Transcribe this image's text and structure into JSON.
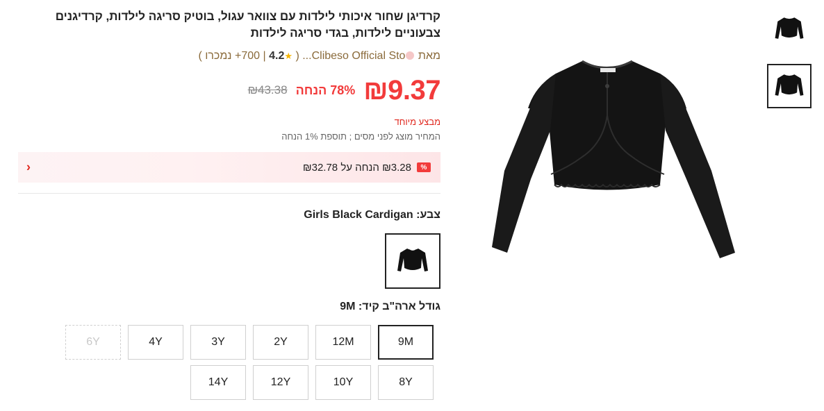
{
  "product": {
    "title": "קרדיגן שחור איכותי לילדות עם צוואר עגול, בוטיק סריגה לילדות, קרדיגנים צבעוניים לילדות, בגדי סריגה לילדות",
    "store_prefix": "מאת",
    "store_name": "Clibeso Official Sto...",
    "rating_open": "(",
    "rating_count": "700",
    "rating_sep": "|",
    "rating_value": "4.2",
    "rating_suffix": "+ נמכרו )",
    "price_now": "₪9.37",
    "discount": "78% הנחה",
    "price_old": "₪43.38",
    "special_offer": "מבצע מיוחד",
    "tax_note": "המחיר מוצג לפני מסים ; תוספת 1% הנחה",
    "coupon_badge": "%",
    "coupon_text": "₪3.28 הנחה על ₪32.78",
    "color_label": "צבע: Girls Black Cardigan",
    "size_label": "גודל ארה\"ב קיד: 9M"
  },
  "sizes_row1": [
    "9M",
    "12M",
    "2Y",
    "3Y",
    "4Y",
    "6Y"
  ],
  "sizes_row2": [
    "8Y",
    "10Y",
    "12Y",
    "14Y"
  ],
  "selected_size": "9M",
  "disabled_size": "6Y",
  "colors": {
    "price": "#f23b3b",
    "store": "#8a6a3a",
    "coupon_bg": "#fde5e7"
  },
  "icons": {
    "chevron": "chevron-left-icon",
    "star": "star-icon",
    "store": "store-icon"
  }
}
